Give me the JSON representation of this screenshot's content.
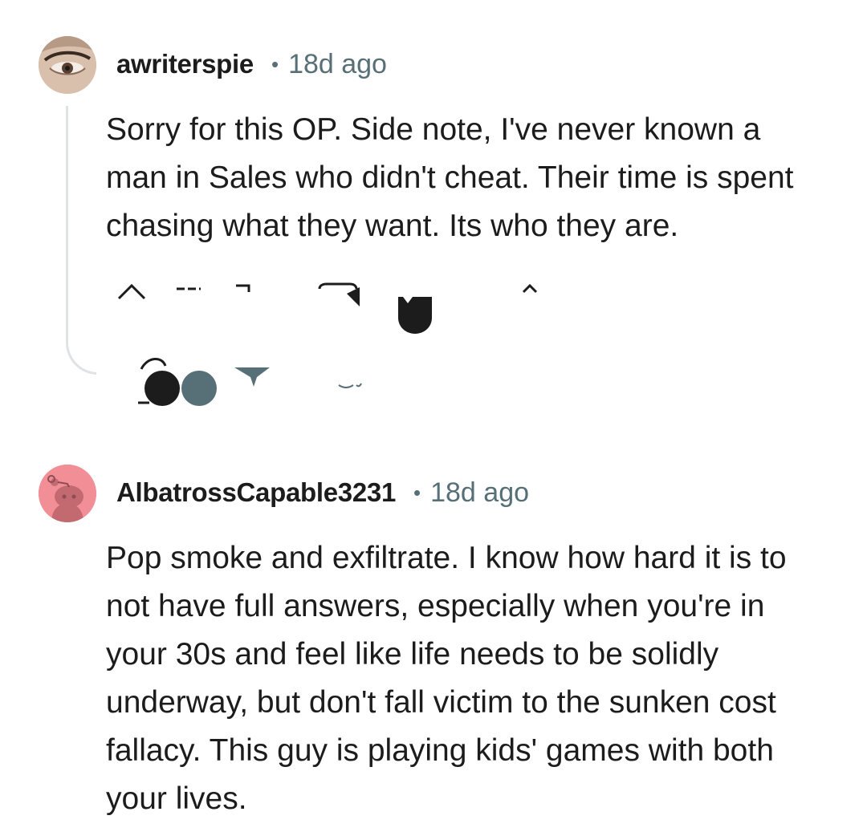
{
  "comments": [
    {
      "username": "awriterspie",
      "separator": "•",
      "time": "18d ago",
      "avatar_icon": "user-photo-avatar",
      "body": "Sorry for this OP. Side note, I've never known a man in Sales who didn't cheat. Their time is spent chasing what they want. Its who they are.",
      "actions": [
        "upvote-icon",
        "downvote-icon",
        "reply-icon",
        "award-icon",
        "share-icon",
        "more-icon"
      ]
    },
    {
      "username": "AlbatrossCapable3231",
      "separator": "•",
      "time": "18d ago",
      "avatar_icon": "snoo-avatar",
      "body": "Pop smoke and exfiltrate. I know how hard it is to not have full answers, especially when you're in your 30s and feel like life needs to be solidly underway, but don't fall victim to the sunken cost fallacy. This guy is playing kids' games with both your lives."
    }
  ],
  "colors": {
    "text": "#1c1c1c",
    "meta": "#576f76",
    "thread_line": "#e0e3e5",
    "snoo_bg": "#f28e96"
  }
}
